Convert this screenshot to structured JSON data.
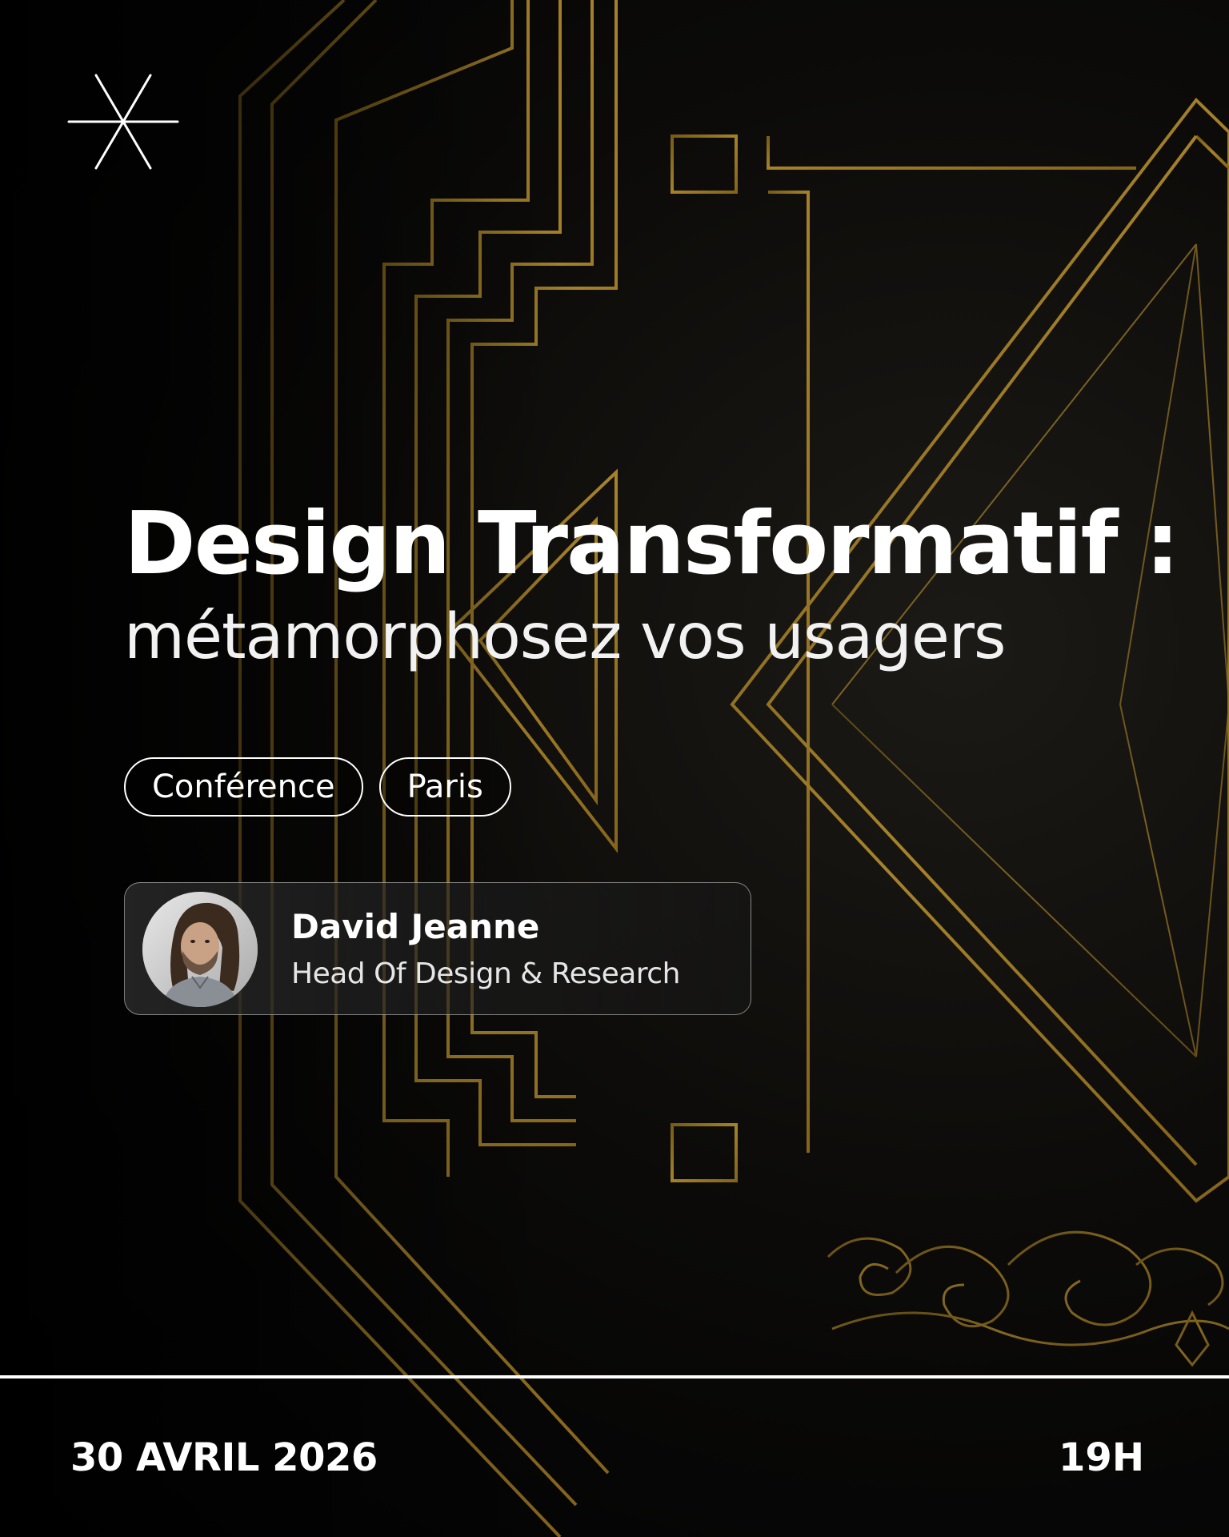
{
  "poster": {
    "title": "Design Transformatif :",
    "subtitle": "métamorphosez vos usagers",
    "tags": [
      {
        "label": "Conférence"
      },
      {
        "label": "Paris"
      }
    ],
    "speaker": {
      "name": "David Jeanne",
      "role": "Head Of Design & Research"
    },
    "footer": {
      "date": "30 AVRIL 2026",
      "time": "19H"
    }
  },
  "icons": {
    "logo": "asterisk-star-icon",
    "avatar": "speaker-avatar"
  },
  "colors": {
    "background": "#000000",
    "gold": "#b8860b",
    "text": "#ffffff"
  }
}
